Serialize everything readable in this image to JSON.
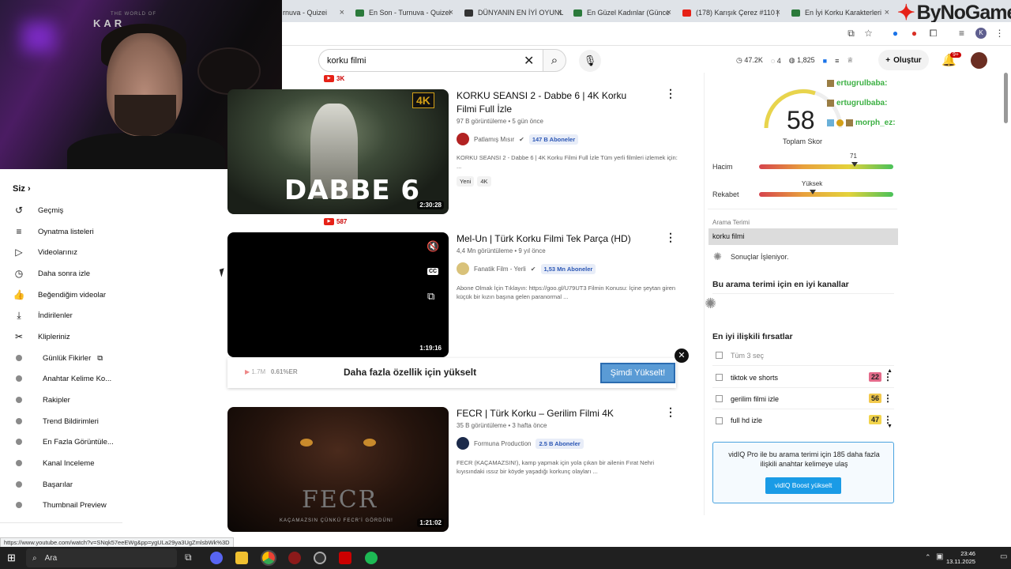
{
  "browser": {
    "tabs": [
      {
        "label": "rnuva - Quizei",
        "color": "#2b7a3b"
      },
      {
        "label": "En Son - Turnuva - Quizei",
        "color": "#2b7a3b"
      },
      {
        "label": "DÜNYANIN EN İYİ OYUNL",
        "color": "#333333"
      },
      {
        "label": "En Güzel Kadınlar (Günce",
        "color": "#2b7a3b"
      },
      {
        "label": "(178) Karışık Çerez #110 |",
        "color": "#e62117"
      },
      {
        "label": "En İyi Korku Karakterleri",
        "color": "#2b7a3b"
      }
    ],
    "profile_initial": "K"
  },
  "watermark": "ByNoGame",
  "webcam": {
    "sign": "KAR",
    "sign_small": "THE WORLD OF"
  },
  "youtube": {
    "search_query": "korku filmi",
    "stats": {
      "views": "47.2K",
      "comments": "4",
      "likes": "1,825"
    },
    "create_label": "Oluştur",
    "notif_badge": "9+"
  },
  "sidebar": {
    "title": "Siz",
    "items": [
      {
        "label": "Geçmiş",
        "icon": "history-icon"
      },
      {
        "label": "Oynatma listeleri",
        "icon": "playlist-icon"
      },
      {
        "label": "Videolarınız",
        "icon": "video-icon"
      },
      {
        "label": "Daha sonra izle",
        "icon": "clock-icon"
      },
      {
        "label": "Beğendiğim videolar",
        "icon": "thumbs-up-icon"
      },
      {
        "label": "İndirilenler",
        "icon": "download-icon"
      },
      {
        "label": "Klipleriniz",
        "icon": "scissors-icon"
      }
    ],
    "vidiq_items": [
      "Günlük Fikirler",
      "Anahtar Kelime Ko...",
      "Rakipler",
      "Trend Bildirimleri",
      "En Fazla Görüntüle...",
      "Kanal Inceleme",
      "Başarılar",
      "Thumbnail Preview"
    ]
  },
  "status_url": "https://www.youtube.com/watch?v=SNqk57eeEWg&pp=ygULa29ya3UgZmlsbWk%3D",
  "videos": [
    {
      "count_above": "3K",
      "title": "KORKU SEANSI 2 - Dabbe 6 | 4K Korku Filmi Full İzle",
      "meta": "97 B görüntüleme • 5 gün önce",
      "channel": "Patlamış Mısır",
      "subs": "147 B Aboneler",
      "desc": "KORKU SEANSI 2 - Dabbe 6 | 4K Korku Filmi Full İzle Tüm yerli filmleri izlemek için: ...",
      "chips": [
        "Yeni",
        "4K"
      ],
      "duration": "2:30:28",
      "thumb_text": "DABBE 6",
      "badge": "4K"
    },
    {
      "count_above": "587",
      "title": "Mel-Un | Türk Korku Filmi Tek Parça (HD)",
      "meta": "4,4 Mn görüntüleme • 9 yıl önce",
      "channel": "Fanatik Film - Yerli",
      "subs": "1,53 Mn Aboneler",
      "desc": "Abone Olmak İçin Tıklayın: https://goo.gl/U79UT3 Filmin Konusu: İçine şeytan giren küçük bir kızın başına gelen paranormal ...",
      "duration": "1:19:16"
    },
    {
      "title": "FECR | Türk Korku – Gerilim Filmi 4K",
      "meta": "35 B görüntüleme • 3 hafta önce",
      "channel": "Formuna Production",
      "subs": "2.5 B Aboneler",
      "desc": "FECR (KAÇAMAZSIN!), kamp yapmak için yola çıkan bir ailenin Fırat Nehri kıyısındaki ıssız bir köyde yaşadığı korkunç olayları ...",
      "duration": "1:21:02",
      "thumb_text": "FECR",
      "thumb_sub": "KAÇAMAZSIN ÇÜNKÜ FECR'İ GÖRDÜN!"
    }
  ],
  "upgrade": {
    "views": "1.7M",
    "er": "0.61%ER",
    "message": "Daha fazla özellik için yükselt",
    "button": "Şimdi Yükselt!"
  },
  "vidiq": {
    "score": "58",
    "score_label": "Toplam Skor",
    "volume_label": "Hacim",
    "volume_value": "71",
    "volume_level": 0.71,
    "competition_label": "Rekabet",
    "competition_value": "Yüksek",
    "competition_level": 0.4,
    "search_term_label": "Arama Terimi",
    "search_term": "korku filmi",
    "processing": "Sonuçlar İşleniyor.",
    "best_channels_title": "Bu arama terimi için en iyi kanallar",
    "opps_title": "En iyi ilişkili fırsatlar",
    "select_all": "Tüm 3 seç",
    "keywords": [
      {
        "label": "tiktok ve shorts",
        "score": "22",
        "color": "#e46a8a"
      },
      {
        "label": "gerilim filmi izle",
        "score": "56",
        "color": "#f2c94c"
      },
      {
        "label": "full hd izle",
        "score": "47",
        "color": "#f2d44c"
      }
    ],
    "promo_text": "vidIQ Pro ile bu arama terimi için 185 daha fazla ilişkili anahtar kelimeye ulaş",
    "promo_button": "vidIQ Boost yükselt"
  },
  "chat": [
    {
      "user": "ertugrulbaba:"
    },
    {
      "user": "ertugrulbaba:"
    },
    {
      "user": "morph_ez:"
    }
  ],
  "taskbar": {
    "search": "Ara",
    "time": "23:46",
    "date": "13.11.2025"
  }
}
